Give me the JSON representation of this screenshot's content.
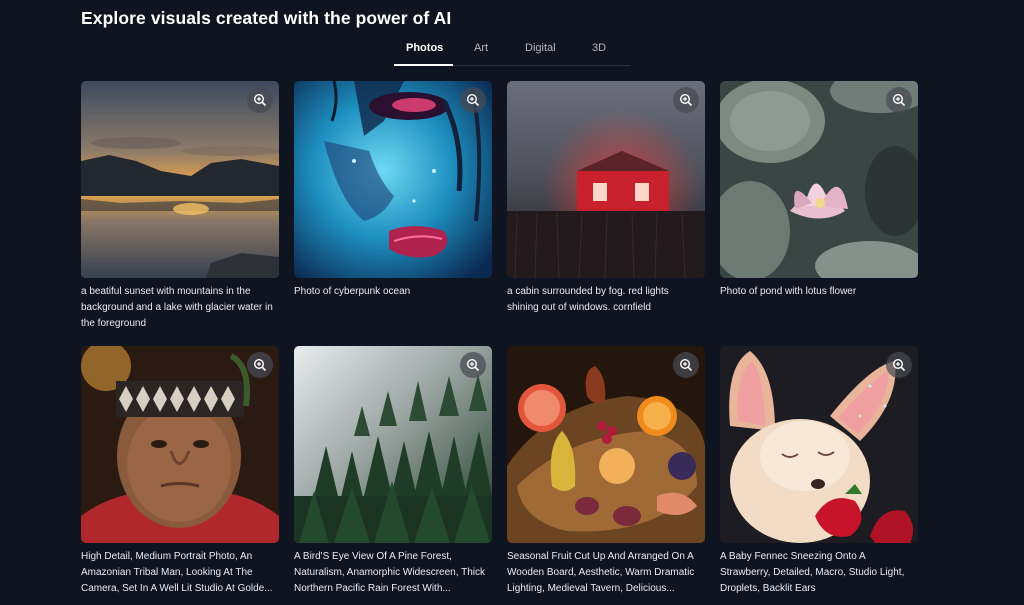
{
  "header": {
    "title": "Explore visuals created with the power of AI"
  },
  "tabs": [
    {
      "label": "Photos",
      "active": true
    },
    {
      "label": "Art",
      "active": false
    },
    {
      "label": "Digital",
      "active": false
    },
    {
      "label": "3D",
      "active": false
    }
  ],
  "gallery": {
    "items": [
      {
        "caption": "a beatiful sunset with mountains in the background and a lake with glacier water in the foreground",
        "icon": "zoom-in-icon"
      },
      {
        "caption": "Photo of cyberpunk ocean",
        "icon": "zoom-in-icon"
      },
      {
        "caption": "a cabin surrounded by fog. red lights shining out of windows. cornfield",
        "icon": "zoom-in-icon"
      },
      {
        "caption": "Photo of pond with lotus flower",
        "icon": "zoom-in-icon"
      },
      {
        "caption": "High Detail, Medium Portrait Photo, An Amazonian Tribal Man, Looking At The Camera, Set In A Well Lit Studio At Golde...",
        "icon": "zoom-in-icon"
      },
      {
        "caption": "A Bird'S Eye View Of A Pine Forest, Naturalism, Anamorphic Widescreen, Thick Northern Pacific Rain Forest With...",
        "icon": "zoom-in-icon"
      },
      {
        "caption": "Seasonal Fruit Cut Up And Arranged On A Wooden Board, Aesthetic, Warm Dramatic Lighting, Medieval Tavern, Delicious...",
        "icon": "zoom-in-icon"
      },
      {
        "caption": "A Baby Fennec Sneezing Onto A Strawberry, Detailed, Macro, Studio Light, Droplets, Backlit Ears",
        "icon": "zoom-in-icon"
      }
    ]
  },
  "colors": {
    "background": "#0e1420",
    "text": "#ffffff",
    "tab_inactive": "#b3bac6"
  }
}
